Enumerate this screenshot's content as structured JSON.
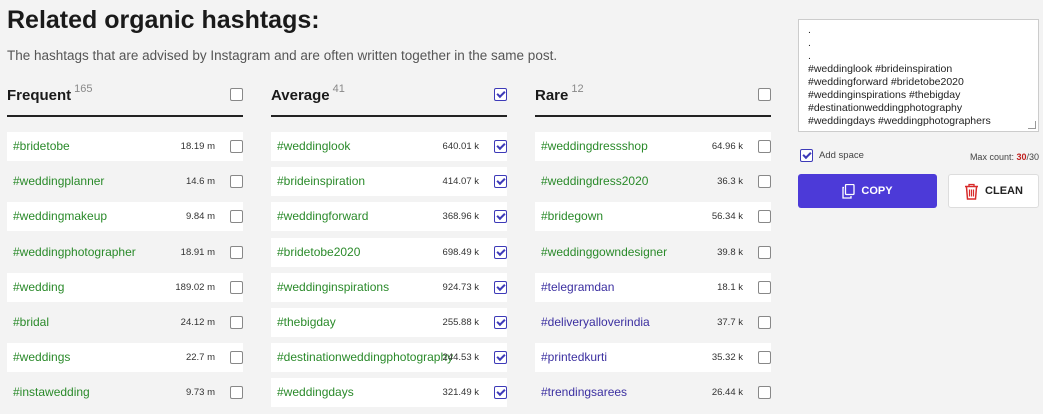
{
  "header": {
    "title": "Related organic hashtags:",
    "subtitle": "The hashtags that are advised by Instagram and are often written together in the same post."
  },
  "columns": [
    {
      "title": "Frequent",
      "count": "165",
      "all_checked": false,
      "tag_color": "green",
      "rows": [
        {
          "tag": "#bridetobe",
          "count": "18.19 m",
          "checked": false
        },
        {
          "tag": "#weddingplanner",
          "count": "14.6 m",
          "checked": false
        },
        {
          "tag": "#weddingmakeup",
          "count": "9.84 m",
          "checked": false
        },
        {
          "tag": "#weddingphotographer",
          "count": "18.91 m",
          "checked": false
        },
        {
          "tag": "#wedding",
          "count": "189.02 m",
          "checked": false
        },
        {
          "tag": "#bridal",
          "count": "24.12 m",
          "checked": false
        },
        {
          "tag": "#weddings",
          "count": "22.7 m",
          "checked": false
        },
        {
          "tag": "#instawedding",
          "count": "9.73 m",
          "checked": false
        }
      ]
    },
    {
      "title": "Average",
      "count": "41",
      "all_checked": true,
      "tag_color": "green",
      "rows": [
        {
          "tag": "#weddinglook",
          "count": "640.01 k",
          "checked": true
        },
        {
          "tag": "#brideinspiration",
          "count": "414.07 k",
          "checked": true
        },
        {
          "tag": "#weddingforward",
          "count": "368.96 k",
          "checked": true
        },
        {
          "tag": "#bridetobe2020",
          "count": "698.49 k",
          "checked": true
        },
        {
          "tag": "#weddinginspirations",
          "count": "924.73 k",
          "checked": true
        },
        {
          "tag": "#thebigday",
          "count": "255.88 k",
          "checked": true
        },
        {
          "tag": "#destinationweddingphotography",
          "count": "244.53 k",
          "checked": true
        },
        {
          "tag": "#weddingdays",
          "count": "321.49 k",
          "checked": true
        }
      ]
    },
    {
      "title": "Rare",
      "count": "12",
      "all_checked": false,
      "tag_color": "mixed",
      "rows": [
        {
          "tag": "#weddingdressshop",
          "count": "64.96 k",
          "checked": false,
          "color": "green"
        },
        {
          "tag": "#weddingdress2020",
          "count": "36.3 k",
          "checked": false,
          "color": "green"
        },
        {
          "tag": "#bridegown",
          "count": "56.34 k",
          "checked": false,
          "color": "green"
        },
        {
          "tag": "#weddinggowndesigner",
          "count": "39.8 k",
          "checked": false,
          "color": "green"
        },
        {
          "tag": "#telegramdan",
          "count": "18.1 k",
          "checked": false,
          "color": "purple"
        },
        {
          "tag": "#deliveryalloverindia",
          "count": "37.7 k",
          "checked": false,
          "color": "purple"
        },
        {
          "tag": "#printedkurti",
          "count": "35.32 k",
          "checked": false,
          "color": "purple"
        },
        {
          "tag": "#trendingsarees",
          "count": "26.44 k",
          "checked": false,
          "color": "purple"
        }
      ]
    }
  ],
  "side": {
    "textarea_lines": [
      ".",
      ".",
      ".",
      "#weddinglook #brideinspiration",
      "#weddingforward #bridetobe2020",
      "#weddinginspirations #thebigday",
      "#destinationweddingphotography",
      "#weddingdays #weddingphotographers"
    ],
    "add_space_label": "Add space",
    "add_space_checked": true,
    "max_count_label": "Max count: ",
    "max_count_current": "30",
    "max_count_total": "/30",
    "copy_label": "COPY",
    "clean_label": "CLEAN"
  },
  "colors": {
    "accent": "#4c3ad8",
    "green_tag": "#2a8a2a",
    "purple_tag": "#3b2fa0",
    "max_red": "#c0201f"
  }
}
